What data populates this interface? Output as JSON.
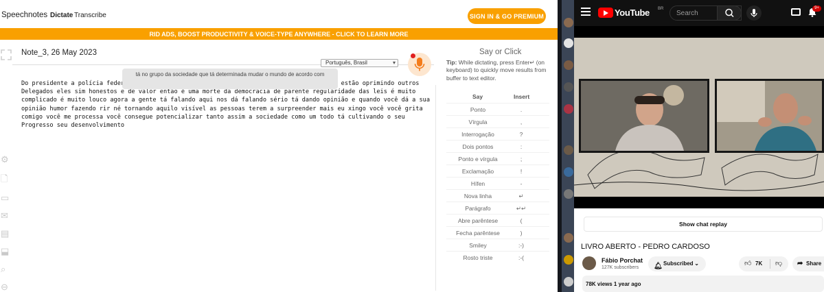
{
  "speechnotes": {
    "brand": "Speechnotes",
    "tabs": [
      "Dictate",
      "Transcribe"
    ],
    "premium_button": "SIGN IN & GO PREMIUM",
    "banner": "RID ADS, BOOST PRODUCTIVITY & VOICE-TYPE ANYWHERE - CLICK TO LEARN MORE",
    "note_title": "Note_3, 26 May 2023",
    "language": "Português, Brasil",
    "interim_popup": "tá no grupo da sociedade que tá determinada mudar o mundo de acordo com",
    "transcript": "Do presidente a polícia federal também tá lá na no comando da polícia federal pessoas que estão oprimindo outros Delegados eles sim honestos e de valor então é uma morte da democracia de parente regularidade das leis é muito complicado é muito louco agora a gente tá falando aqui nos dá falando sério tá dando opinião e quando você dá a sua opinião humor fazendo rir né tornando aquilo visível as pessoas terem a surpreender mais eu xingo você você grita comigo você me processa você consegue potencializar tanto assim a sociedade como um todo tá cultivando o seu Progresso seu desenvolvimento",
    "say_or_click": {
      "title": "Say or Click",
      "tip_label": "Tip:",
      "tip_text": " While dictating, press Enter↵ (on keyboard) to quickly move results from buffer to text editor.",
      "col_say": "Say",
      "col_insert": "Insert",
      "rows": [
        {
          "say": "Ponto",
          "insert": "."
        },
        {
          "say": "Vírgula",
          "insert": ","
        },
        {
          "say": "Interrogação",
          "insert": "?"
        },
        {
          "say": "Dois pontos",
          "insert": ":"
        },
        {
          "say": "Ponto e vírgula",
          "insert": ";"
        },
        {
          "say": "Exclamação",
          "insert": "!"
        },
        {
          "say": "Hífen",
          "insert": "-"
        },
        {
          "say": "Nova linha",
          "insert": "↵"
        },
        {
          "say": "Parágrafo",
          "insert": "↵↵"
        },
        {
          "say": "Abre parêntese",
          "insert": "("
        },
        {
          "say": "Fecha parêntese",
          "insert": ")"
        },
        {
          "say": "Smiley",
          "insert": ":-)"
        },
        {
          "say": "Rosto triste",
          "insert": ":-("
        }
      ]
    }
  },
  "youtube": {
    "logo_text": "YouTube",
    "country": "BR",
    "search_placeholder": "Search",
    "notifications": "9+",
    "show_chat": "Show chat replay",
    "video_title": "LIVRO ABERTO - PEDRO CARDOSO",
    "channel_name": "Fábio Porchat",
    "subscribers": "127K subscribers",
    "subscribed_label": "Subscribed",
    "likes": "7K",
    "share_label": "Share",
    "views_date": "78K views  1 year ago"
  }
}
